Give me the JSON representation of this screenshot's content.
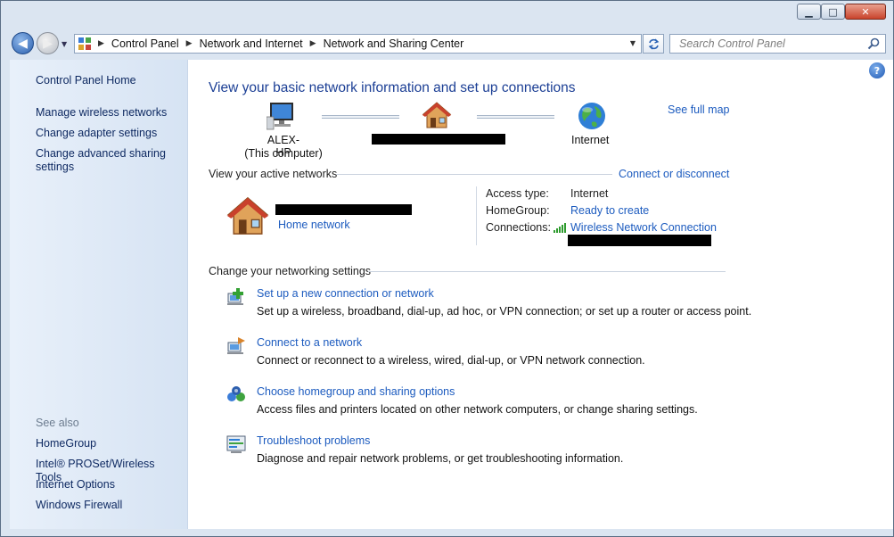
{
  "window": {
    "minimize_glyph": "▁",
    "maximize_glyph": "□",
    "close_glyph": "✕"
  },
  "nav": {
    "back_glyph": "◀",
    "forward_glyph": "▶",
    "breadcrumbs": [
      "Control Panel",
      "Network and Internet",
      "Network and Sharing Center"
    ],
    "search_placeholder": "Search Control Panel"
  },
  "sidebar": {
    "home": "Control Panel Home",
    "tasks": [
      "Manage wireless networks",
      "Change adapter settings",
      "Change advanced sharing settings"
    ],
    "see_also_heading": "See also",
    "see_also": [
      "HomeGroup",
      "Intel® PROSet/Wireless Tools",
      "Internet Options",
      "Windows Firewall"
    ]
  },
  "main": {
    "title": "View your basic network information and set up connections",
    "see_full_map": "See full map",
    "map": {
      "computer_name": "ALEX-HP",
      "computer_sub": "(This computer)",
      "internet_label": "Internet"
    },
    "active_networks": {
      "heading": "View your active networks",
      "connect_link": "Connect or disconnect",
      "network_type": "Home network",
      "access_type_label": "Access type:",
      "access_type_value": "Internet",
      "homegroup_label": "HomeGroup:",
      "homegroup_value": "Ready to create",
      "connections_label": "Connections:",
      "connections_value": "Wireless Network Connection"
    },
    "settings_heading": "Change your networking settings",
    "tasks": [
      {
        "title": "Set up a new connection or network",
        "desc": "Set up a wireless, broadband, dial-up, ad hoc, or VPN connection; or set up a router or access point.",
        "icon": "new-connection-icon"
      },
      {
        "title": "Connect to a network",
        "desc": "Connect or reconnect to a wireless, wired, dial-up, or VPN network connection.",
        "icon": "connect-network-icon"
      },
      {
        "title": "Choose homegroup and sharing options",
        "desc": "Access files and printers located on other network computers, or change sharing settings.",
        "icon": "homegroup-icon"
      },
      {
        "title": "Troubleshoot problems",
        "desc": "Diagnose and repair network problems, or get troubleshooting information.",
        "icon": "troubleshoot-icon"
      }
    ]
  }
}
